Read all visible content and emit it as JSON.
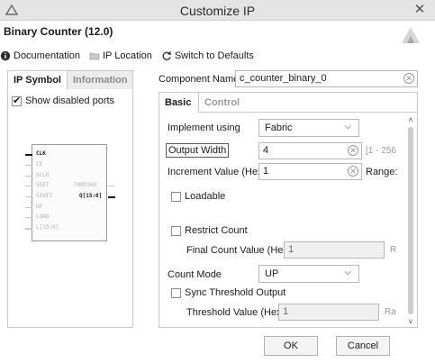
{
  "window": {
    "title": "Customize IP",
    "close_glyph": "✕"
  },
  "dialog": {
    "title": "Binary Counter (12.0)"
  },
  "toolbar": {
    "documentation": "Documentation",
    "ip_location": "IP Location",
    "switch_defaults": "Switch to Defaults"
  },
  "left": {
    "tabs": [
      "IP Symbol",
      "Information"
    ],
    "show_disabled_ports": "Show disabled ports",
    "symbol": {
      "inputs": [
        "CLK",
        "CE",
        "SCLR",
        "SSET",
        "SINIT",
        "UP",
        "LOAD",
        "L[15:0]"
      ],
      "outputs": [
        "THRESH0",
        "Q[15:0]"
      ]
    }
  },
  "component": {
    "label": "Component Name",
    "value": "c_counter_binary_0"
  },
  "settings": {
    "tabs": [
      "Basic",
      "Control"
    ],
    "implement_using": {
      "label": "Implement using",
      "value": "Fabric"
    },
    "output_width": {
      "label": "Output Width",
      "value": "4",
      "hint": "[1 - 256"
    },
    "increment_value": {
      "label": "Increment Value (Hex)",
      "value": "1",
      "hint": "Range:"
    },
    "loadable": "Loadable",
    "restrict_count": "Restrict Count",
    "final_count": {
      "label": "Final Count Value (Hex)",
      "value": "1",
      "hint": "R"
    },
    "count_mode": {
      "label": "Count Mode",
      "value": "UP"
    },
    "sync_threshold": "Sync Threshold Output",
    "threshold_value": {
      "label": "Threshold Value (Hex)",
      "value": "1",
      "hint": "Ra"
    }
  },
  "buttons": {
    "ok": "OK",
    "cancel": "Cancel"
  }
}
